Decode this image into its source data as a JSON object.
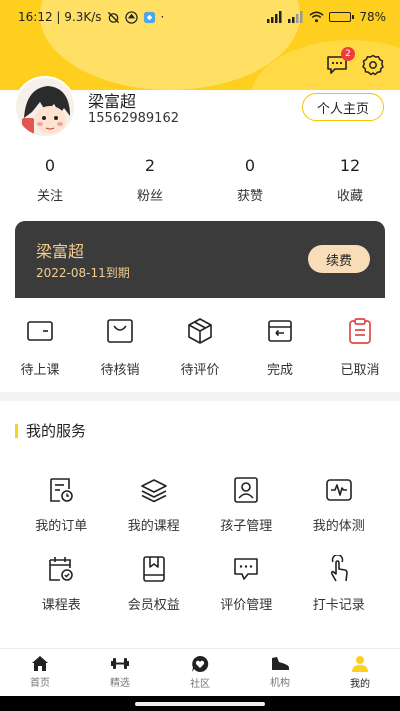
{
  "status_bar": {
    "time_speed": "16:12 | 9.3K/s",
    "battery": "78%",
    "battery_level": 0.78
  },
  "header": {
    "message_badge": "2"
  },
  "profile": {
    "name": "梁富超",
    "phone": "15562989162",
    "home_button": "个人主页"
  },
  "stats": [
    {
      "value": "0",
      "label": "关注"
    },
    {
      "value": "2",
      "label": "粉丝"
    },
    {
      "value": "0",
      "label": "获赞"
    },
    {
      "value": "12",
      "label": "收藏"
    }
  ],
  "vip": {
    "name": "梁富超",
    "expire": "2022-08-11到期",
    "renew": "续费"
  },
  "orders": [
    {
      "label": "待上课",
      "icon": "wallet-icon"
    },
    {
      "label": "待核销",
      "icon": "bag-icon"
    },
    {
      "label": "待评价",
      "icon": "box-icon"
    },
    {
      "label": "完成",
      "icon": "return-icon"
    },
    {
      "label": "已取消",
      "icon": "clipboard-icon"
    }
  ],
  "services_title": "我的服务",
  "services": [
    {
      "label": "我的订单",
      "icon": "order-clock-icon"
    },
    {
      "label": "我的课程",
      "icon": "layers-icon"
    },
    {
      "label": "孩子管理",
      "icon": "person-card-icon"
    },
    {
      "label": "我的体测",
      "icon": "pulse-icon"
    },
    {
      "label": "课程表",
      "icon": "calendar-check-icon"
    },
    {
      "label": "会员权益",
      "icon": "bookmark-box-icon"
    },
    {
      "label": "评价管理",
      "icon": "comment-icon"
    },
    {
      "label": "打卡记录",
      "icon": "tap-hand-icon"
    }
  ],
  "tabs": [
    {
      "label": "首页",
      "icon": "home-icon"
    },
    {
      "label": "精选",
      "icon": "dumbbell-icon"
    },
    {
      "label": "社区",
      "icon": "heart-bubble-icon"
    },
    {
      "label": "机构",
      "icon": "shoe-icon"
    },
    {
      "label": "我的",
      "icon": "user-icon"
    }
  ],
  "colors": {
    "brand_yellow": "#ffcf1f",
    "vip_card": "#3b3b3c",
    "vip_text": "#f4cd8e",
    "renew_button": "#f8ddb8",
    "badge_red": "#ef3b3b"
  }
}
